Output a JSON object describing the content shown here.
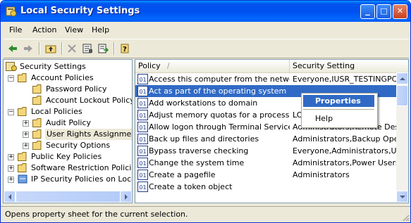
{
  "window": {
    "title": "Local Security Settings",
    "icon": "security-settings-icon"
  },
  "titlebar_buttons": {
    "minimize": "_",
    "maximize": "□",
    "close": "✕"
  },
  "menubar": {
    "items": [
      "File",
      "Action",
      "View",
      "Help"
    ]
  },
  "toolbar": {
    "icons": [
      "back-arrow-icon",
      "forward-arrow-icon",
      "up-folder-icon",
      "delete-icon",
      "properties-icon",
      "export-list-icon",
      "help-icon"
    ]
  },
  "tree": {
    "root": "Security Settings",
    "items": [
      "Account Policies",
      "Password Policy",
      "Account Lockout Policy",
      "Local Policies",
      "Audit Policy",
      "User Rights Assignment",
      "Security Options",
      "Public Key Policies",
      "Software Restriction Policies",
      "IP Security Policies on Local C"
    ]
  },
  "list": {
    "columns": [
      "Policy",
      "Security Setting"
    ],
    "sort_indicator": "/",
    "rows": [
      {
        "policy": "Access this computer from the network",
        "setting": "Everyone,IUSR_TESTINGPC,IW"
      },
      {
        "policy": "Act as part of the operating system",
        "setting": ""
      },
      {
        "policy": "Add workstations to domain",
        "setting": ""
      },
      {
        "policy": "Adjust memory quotas for a process",
        "setting": "LO                         ORK SE"
      },
      {
        "policy": "Allow logon through Terminal Services",
        "setting": "Administrators,Remote Deskto"
      },
      {
        "policy": "Back up files and directories",
        "setting": "Administrators,Backup Operato"
      },
      {
        "policy": "Bypass traverse checking",
        "setting": "Everyone,Administrators,User"
      },
      {
        "policy": "Change the system time",
        "setting": "Administrators,Power Users"
      },
      {
        "policy": "Create a pagefile",
        "setting": "Administrators"
      },
      {
        "policy": "Create a token object",
        "setting": ""
      }
    ]
  },
  "context_menu": {
    "items": [
      "Properties",
      "Help"
    ]
  },
  "statusbar": {
    "text": "Opens property sheet for the current selection."
  },
  "colors": {
    "selection": "#316AC5",
    "titlebar": "#0053EE",
    "chrome": "#ECE9D8"
  }
}
